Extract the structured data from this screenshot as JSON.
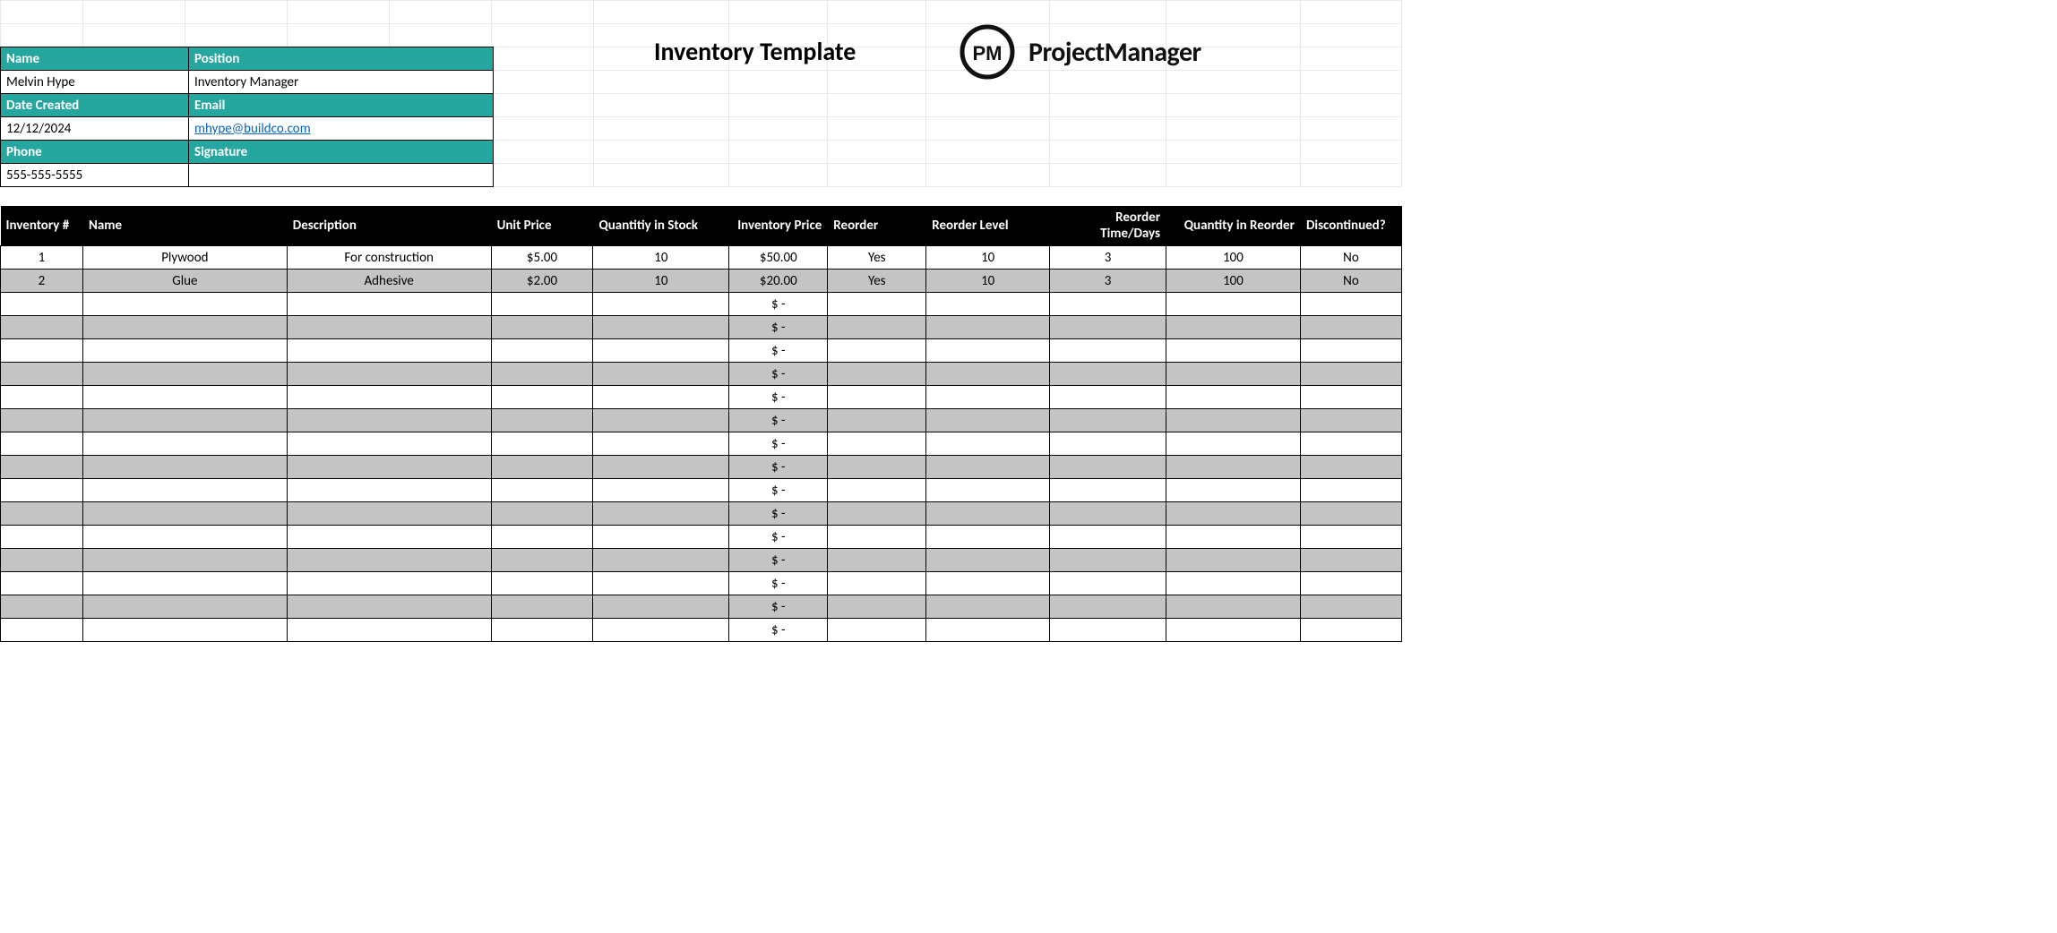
{
  "title": "Inventory Template",
  "brand": "ProjectManager",
  "brand_badge": "PM",
  "meta": {
    "name_label": "Name",
    "name_value": "Melvin Hype",
    "position_label": "Position",
    "position_value": "Inventory Manager",
    "date_label": "Date Created",
    "date_value": "12/12/2024",
    "email_label": "Email",
    "email_value": "mhype@buildco.com",
    "phone_label": "Phone",
    "phone_value": "555-555-5555",
    "signature_label": "Signature",
    "signature_value": ""
  },
  "columns": {
    "inventory_num": "Inventory #",
    "name": "Name",
    "description": "Description",
    "unit_price": "Unit Price",
    "qty_stock": "Quantitiy in Stock",
    "inv_price": "Inventory Price",
    "reorder": "Reorder",
    "reorder_level": "Reorder Level",
    "reorder_time": "Reorder Time/Days",
    "qty_reorder": "Quantity in Reorder",
    "discontinued": "Discontinued?"
  },
  "rows": [
    {
      "num": "1",
      "name": "Plywood",
      "desc": "For construction",
      "unit": "$5.00",
      "qty": "10",
      "invp": "$50.00",
      "reo": "Yes",
      "lvl": "10",
      "time": "3",
      "qreo": "100",
      "disc": "No"
    },
    {
      "num": "2",
      "name": "Glue",
      "desc": "Adhesive",
      "unit": "$2.00",
      "qty": "10",
      "invp": "$20.00",
      "reo": "Yes",
      "lvl": "10",
      "time": "3",
      "qreo": "100",
      "disc": "No"
    }
  ],
  "empty_inv_price": "$ -",
  "empty_row_count": 15
}
